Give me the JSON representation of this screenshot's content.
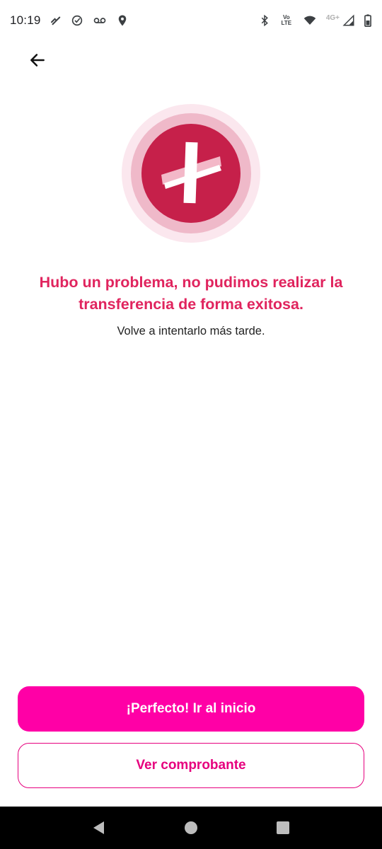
{
  "status_bar": {
    "time": "10:19",
    "left_icons": [
      "missed-call-icon",
      "check-circle-icon",
      "voicemail-icon",
      "location-pin-icon"
    ],
    "right_icons": [
      "bluetooth-icon",
      "volte-icon",
      "wifi-icon",
      "signal-icon",
      "battery-icon"
    ],
    "volte_top": "Vo",
    "volte_bottom": "LTE",
    "network_type": "4G+"
  },
  "header": {
    "back_icon": "arrow-left-icon"
  },
  "illustration": {
    "icon": "error-x-icon",
    "colors": {
      "outer_ring": "#fbe7ee",
      "middle_ring": "#efb9c9",
      "circle": "#c6204a",
      "mark": "#ffffff"
    }
  },
  "message": {
    "title": "Hubo un problema, no pudimos realizar la transferencia de forma exitosa.",
    "subtitle": "Volve a intentarlo más tarde."
  },
  "actions": {
    "primary_label": "¡Perfecto! Ir al inicio",
    "secondary_label": "Ver comprobante",
    "primary_color": "#ff00a6",
    "secondary_color": "#e6007e"
  },
  "nav_bar": {
    "buttons": [
      "back-triangle-icon",
      "home-circle-icon",
      "recents-square-icon"
    ]
  }
}
